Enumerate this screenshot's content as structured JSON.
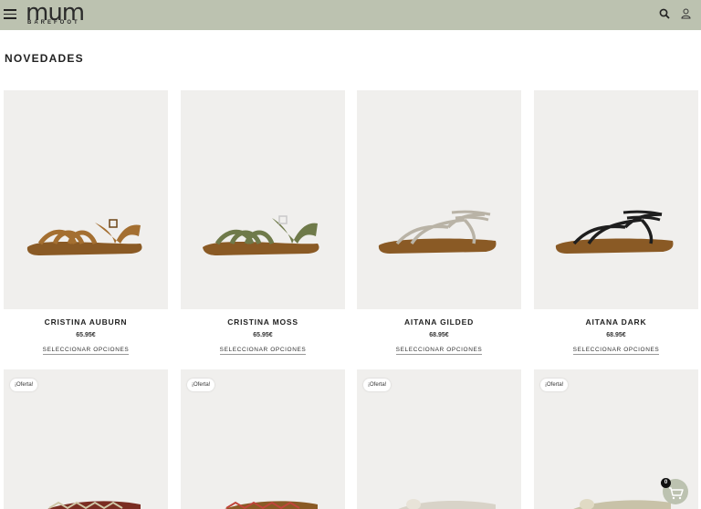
{
  "header": {
    "logo_main": "mum",
    "logo_sub": "BAREFOOT",
    "menu_icon": "hamburger-icon",
    "search_icon": "search-icon",
    "account_icon": "user-icon",
    "background": "#bcc2b0"
  },
  "section": {
    "title": "NOVEDADES"
  },
  "products": [
    {
      "name": "CRISTINA AUBURN",
      "price": "65.95€",
      "button": "SELECCIONAR OPCIONES",
      "color": "#9a6a2f"
    },
    {
      "name": "CRISTINA MOSS",
      "price": "65.95€",
      "button": "SELECCIONAR OPCIONES",
      "color": "#6f7a4a"
    },
    {
      "name": "AITANA GILDED",
      "price": "68.95€",
      "button": "SELECCIONAR OPCIONES",
      "color": "#b9b3a6"
    },
    {
      "name": "AITANA DARK",
      "price": "68.95€",
      "button": "SELECCIONAR OPCIONES",
      "color": "#1e1e1e"
    }
  ],
  "offers": [
    {
      "badge": "¡Oferta!"
    },
    {
      "badge": "¡Oferta!"
    },
    {
      "badge": "¡Oferta!"
    },
    {
      "badge": "¡Oferta!"
    }
  ],
  "cart": {
    "count": "0",
    "icon": "cart-icon"
  }
}
